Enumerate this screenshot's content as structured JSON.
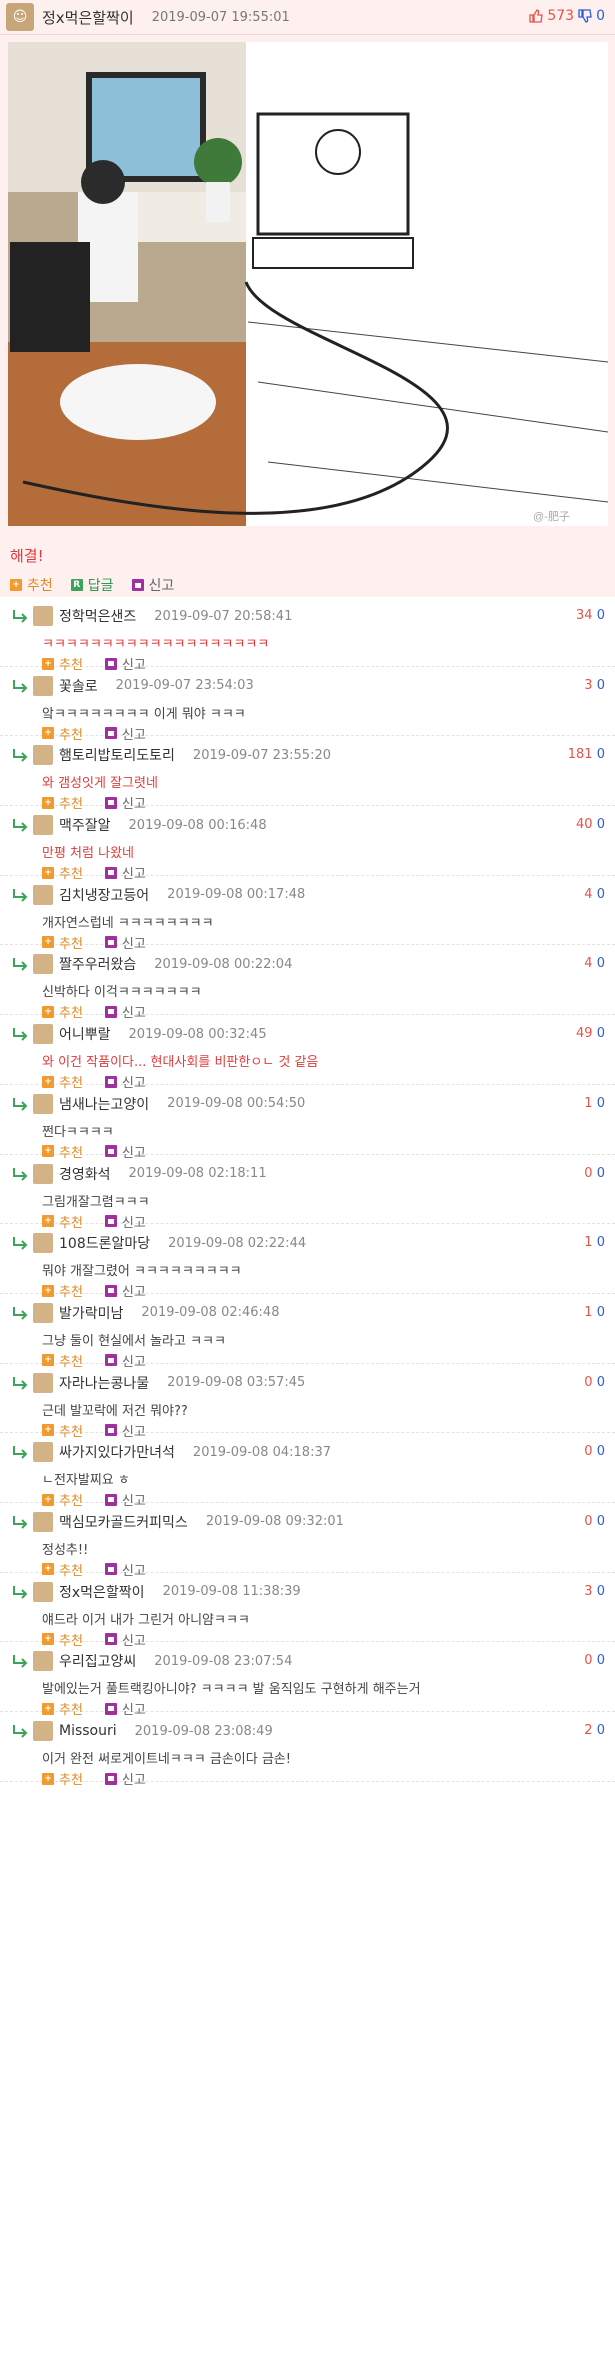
{
  "post": {
    "author": "정x먹은할짝이",
    "time": "2019-09-07 19:55:01",
    "upvotes": "573",
    "downvotes": "0",
    "body": "해결!",
    "actions": {
      "recommend": "추천",
      "reply": "답글",
      "report": "신고"
    },
    "image_caption": "@-肥子"
  },
  "comments": [
    {
      "name": "정학먹은샌즈",
      "time": "2019-09-07 20:58:41",
      "up": "34",
      "down": "0",
      "text": "ㅋㅋㅋㅋㅋㅋㅋㅋㅋㅋㅋㅋㅋㅋㅋㅋㅋㅋㅋ",
      "red": true
    },
    {
      "name": "꽃솔로",
      "time": "2019-09-07 23:54:03",
      "up": "3",
      "down": "0",
      "text": "앜ㅋㅋㅋㅋㅋㅋㅋㅋ 이게 뭐야 ㅋㅋㅋ",
      "red": false
    },
    {
      "name": "햄토리밥토리도토리",
      "time": "2019-09-07 23:55:20",
      "up": "181",
      "down": "0",
      "text": "와 갬성잇게 잘그렷네",
      "red": true
    },
    {
      "name": "맥주잘알",
      "time": "2019-09-08 00:16:48",
      "up": "40",
      "down": "0",
      "text": "만평 처럼 나왔네",
      "red": true
    },
    {
      "name": "김치냉장고등어",
      "time": "2019-09-08 00:17:48",
      "up": "4",
      "down": "0",
      "text": "개자연스럽네 ㅋㅋㅋㅋㅋㅋㅋㅋ",
      "red": false
    },
    {
      "name": "짤주우러왔슴",
      "time": "2019-09-08 00:22:04",
      "up": "4",
      "down": "0",
      "text": "신박하다 이걱ㅋㅋㅋㅋㅋㅋㅋ",
      "red": false
    },
    {
      "name": "어니뿌랄",
      "time": "2019-09-08 00:32:45",
      "up": "49",
      "down": "0",
      "text": "와 이건 작품이다... 현대사회를 비판한ㅇㄴ 것 같음",
      "red": true
    },
    {
      "name": "냄새나는고양이",
      "time": "2019-09-08 00:54:50",
      "up": "1",
      "down": "0",
      "text": "쩐다ㅋㅋㅋㅋ",
      "red": false
    },
    {
      "name": "경영화석",
      "time": "2019-09-08 02:18:11",
      "up": "0",
      "down": "0",
      "text": "그림개잘그렴ㅋㅋㅋ",
      "red": false
    },
    {
      "name": "108드론알마당",
      "time": "2019-09-08 02:22:44",
      "up": "1",
      "down": "0",
      "text": "뭐야 개잘그렸어 ㅋㅋㅋㅋㅋㅋㅋㅋㅋ",
      "red": false
    },
    {
      "name": "발가락미남",
      "time": "2019-09-08 02:46:48",
      "up": "1",
      "down": "0",
      "text": "그냥 둘이 현실에서 놀라고 ㅋㅋㅋ",
      "red": false
    },
    {
      "name": "자라나는콩나물",
      "time": "2019-09-08 03:57:45",
      "up": "0",
      "down": "0",
      "text": "근데 발꼬락에 저건 뭐야??",
      "red": false
    },
    {
      "name": "싸가지있다가만녀석",
      "time": "2019-09-08 04:18:37",
      "up": "0",
      "down": "0",
      "text": "ㄴ전자발찌요 ㅎ",
      "red": false
    },
    {
      "name": "맥심모카골드커피믹스",
      "time": "2019-09-08 09:32:01",
      "up": "0",
      "down": "0",
      "text": "정성추!!",
      "red": false
    },
    {
      "name": "정x먹은할짝이",
      "time": "2019-09-08 11:38:39",
      "up": "3",
      "down": "0",
      "text": "얘드라 이거 내가 그린거 아니얌ㅋㅋㅋ",
      "red": false
    },
    {
      "name": "우리집고양씨",
      "time": "2019-09-08 23:07:54",
      "up": "0",
      "down": "0",
      "text": "발에있는거 풀트랙킹아니야? ㅋㅋㅋㅋ 발 움직임도 구현하게 해주는거",
      "red": false
    },
    {
      "name": "Missouri",
      "time": "2019-09-08 23:08:49",
      "up": "2",
      "down": "0",
      "text": "이거 완전 써로게이트네ㅋㅋㅋ 금손이다 금손!",
      "red": false
    }
  ],
  "colors": {
    "up": "#e5534b",
    "down": "#2e5bd7",
    "accent": "#e03b3b"
  }
}
